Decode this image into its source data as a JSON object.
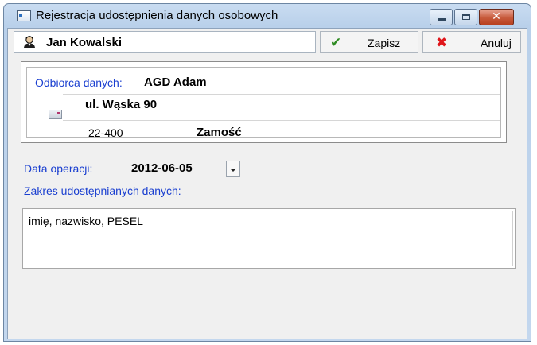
{
  "window": {
    "title": "Rejestracja udostępnienia danych osobowych",
    "buttons": {
      "close_label": "✕"
    }
  },
  "toolbar": {
    "person_name": "Jan Kowalski",
    "save_label": "Zapisz",
    "save_icon": "✔",
    "cancel_label": "Anuluj",
    "cancel_icon": "✖"
  },
  "recipient": {
    "label": "Odbiorca danych:",
    "name": "AGD Adam",
    "street": "ul. Wąska 90",
    "postal_code": "22-400",
    "city": "Zamość"
  },
  "operation": {
    "date_label": "Data operacji:",
    "date_value": "2012-06-05"
  },
  "scope": {
    "label": "Zakres udostępnianych danych:",
    "value_before_caret": "imię, nazwisko, P",
    "value_after_caret": "ESEL"
  },
  "colors": {
    "label_blue": "#1a3fd0",
    "save_green": "#2e8b22",
    "cancel_red": "#e0161b"
  }
}
